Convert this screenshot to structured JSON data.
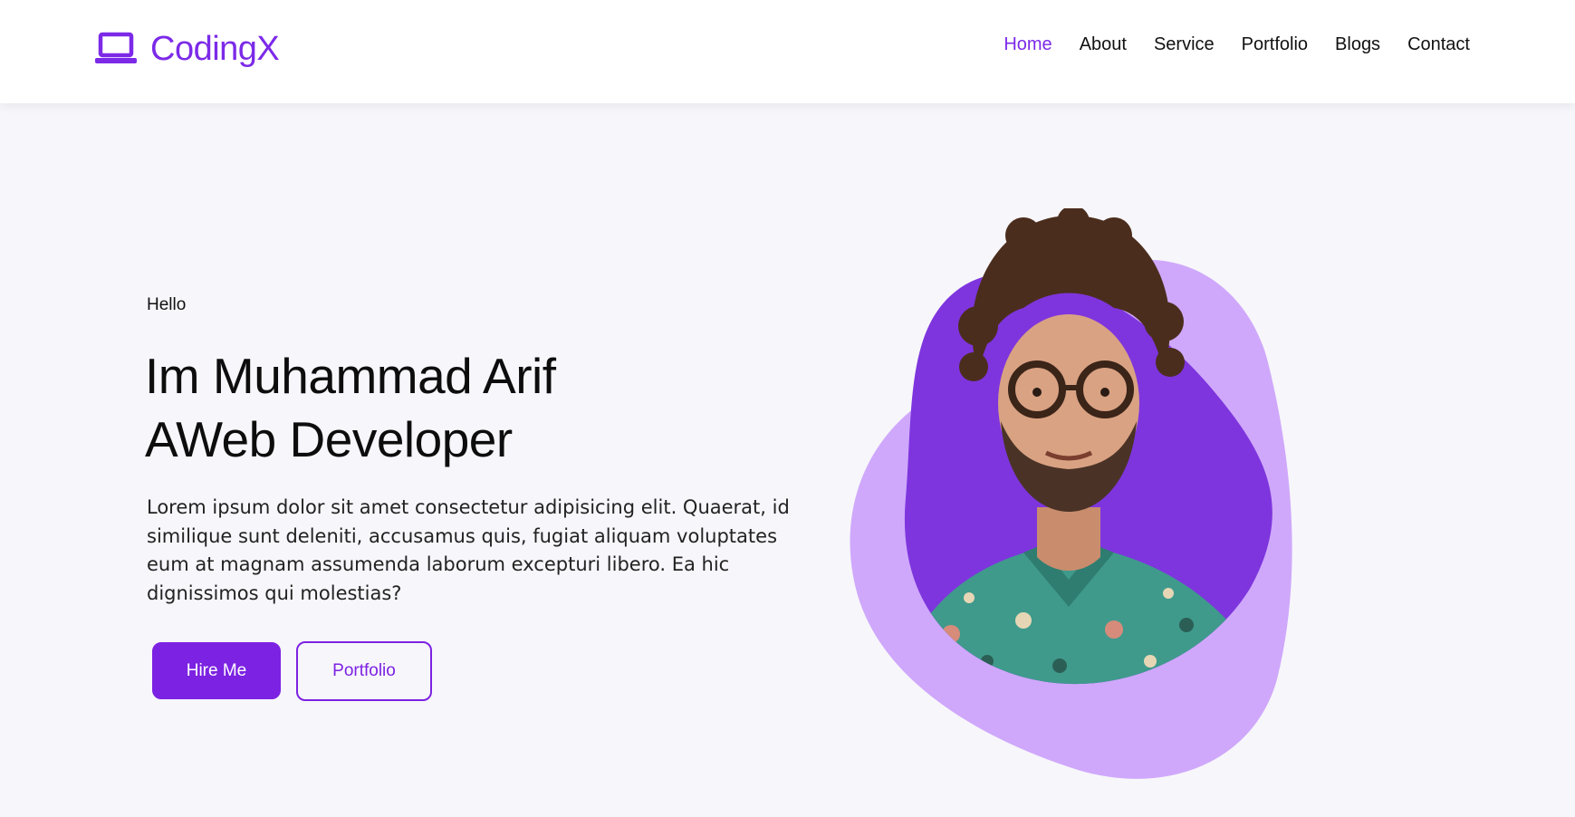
{
  "brand": {
    "name": "CodingX",
    "icon": "laptop-icon",
    "color": "#7c2ae8"
  },
  "nav": {
    "items": [
      {
        "label": "Home",
        "active": true
      },
      {
        "label": "About",
        "active": false
      },
      {
        "label": "Service",
        "active": false
      },
      {
        "label": "Portfolio",
        "active": false
      },
      {
        "label": "Blogs",
        "active": false
      },
      {
        "label": "Contact",
        "active": false
      }
    ]
  },
  "hero": {
    "greeting": "Hello",
    "title_line1": "Im Muhammad Arif",
    "title_line2": "AWeb Developer",
    "description": "Lorem ipsum dolor sit amet consectetur adipisicing elit. Quaerat, id similique sunt deleniti, accusamus quis, fugiat aliquam voluptates eum at magnam assumenda laborum excepturi libero. Ea hic dignissimos qui molestias?",
    "primary_button": "Hire Me",
    "secondary_button": "Portfolio"
  },
  "colors": {
    "accent": "#7c22e2",
    "blob_light": "#cfa8fb",
    "blob_dark": "#7e35dd",
    "background": "#f7f6fb"
  }
}
